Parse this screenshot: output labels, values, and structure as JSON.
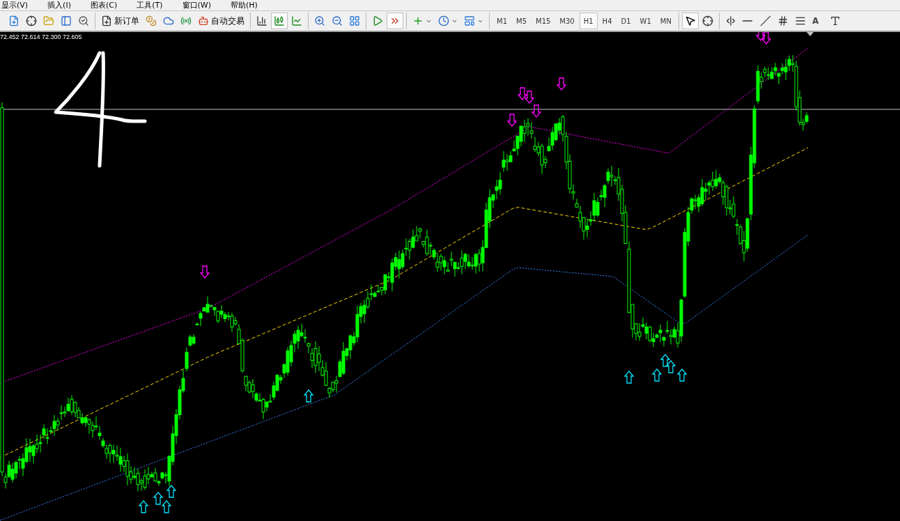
{
  "menu": [
    {
      "label": "显示(V)"
    },
    {
      "label": "插入(I)"
    },
    {
      "label": "图表(C)"
    },
    {
      "label": "工具(T)"
    },
    {
      "label": "窗口(W)"
    },
    {
      "label": "帮助(H)"
    }
  ],
  "toolbar": {
    "groups": [
      [
        {
          "kind": "icon",
          "selected": false
        },
        {
          "kind": "icon",
          "selected": false
        },
        {
          "kind": "icon",
          "selected": false
        },
        {
          "kind": "icon",
          "selected": false
        },
        {
          "kind": "icon",
          "selected": false
        }
      ],
      [
        {
          "kind": "button",
          "label": "新订单"
        },
        {
          "kind": "icon",
          "selected": false
        },
        {
          "kind": "icon",
          "selected": false
        },
        {
          "kind": "icon",
          "selected": false
        },
        {
          "kind": "button",
          "label": "自动交易"
        }
      ],
      [
        {
          "kind": "icon",
          "selected": false
        },
        {
          "kind": "icon",
          "selected": true
        },
        {
          "kind": "icon",
          "selected": false
        }
      ],
      [
        {
          "kind": "icon",
          "selected": false
        },
        {
          "kind": "icon",
          "selected": false
        },
        {
          "kind": "icon",
          "selected": false
        }
      ],
      [
        {
          "kind": "icon",
          "selected": false
        },
        {
          "kind": "icon",
          "selected": true
        }
      ],
      [
        {
          "kind": "dropdown"
        },
        {
          "kind": "dropdown"
        },
        {
          "kind": "dropdown"
        }
      ],
      [
        {
          "kind": "timeframe",
          "label": "M1",
          "selected": false
        },
        {
          "kind": "timeframe",
          "label": "M5",
          "selected": false
        },
        {
          "kind": "timeframe",
          "label": "M15",
          "selected": false
        },
        {
          "kind": "timeframe",
          "label": "M30",
          "selected": false
        },
        {
          "kind": "timeframe",
          "label": "H1",
          "selected": true
        },
        {
          "kind": "timeframe",
          "label": "H4",
          "selected": false
        },
        {
          "kind": "timeframe",
          "label": "D1",
          "selected": false
        },
        {
          "kind": "timeframe",
          "label": "W1",
          "selected": false
        },
        {
          "kind": "timeframe",
          "label": "MN",
          "selected": false
        }
      ],
      [
        {
          "kind": "icon",
          "selected": true
        },
        {
          "kind": "icon",
          "selected": false
        }
      ],
      [
        {
          "kind": "icon",
          "selected": false
        },
        {
          "kind": "icon",
          "selected": false
        },
        {
          "kind": "icon",
          "selected": false
        },
        {
          "kind": "icon",
          "selected": false
        },
        {
          "kind": "icon",
          "selected": false
        },
        {
          "kind": "text_tool",
          "label": "A"
        },
        {
          "kind": "icon",
          "selected": false
        }
      ]
    ]
  },
  "chart": {
    "ohlc": "72.452 72.614 72.300 72.605"
  }
}
